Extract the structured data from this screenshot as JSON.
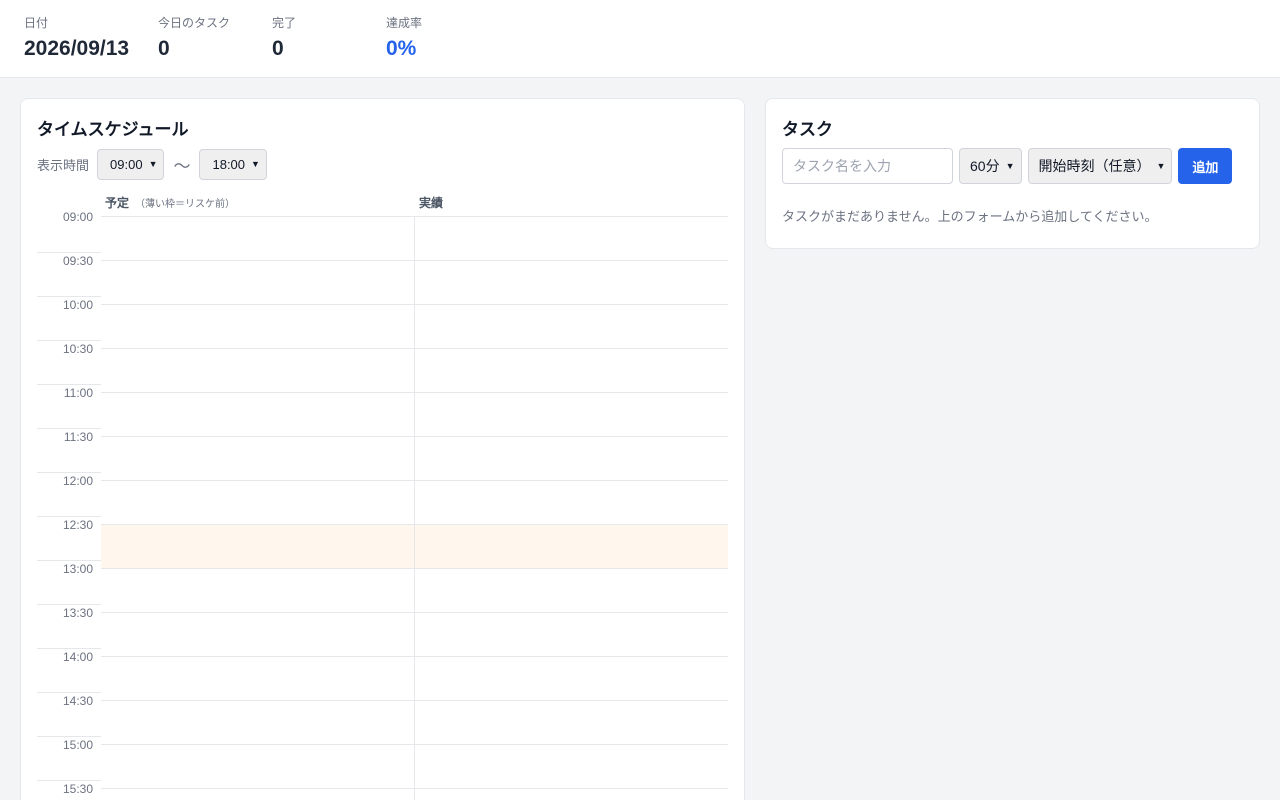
{
  "stats": [
    {
      "label": "日付",
      "value": "2026/09/13",
      "accent": false
    },
    {
      "label": "今日のタスク",
      "value": "0",
      "accent": false
    },
    {
      "label": "完了",
      "value": "0",
      "accent": false
    },
    {
      "label": "達成率",
      "value": "0%",
      "accent": true
    }
  ],
  "schedule": {
    "title": "タイムスケジュール",
    "range_label": "表示時間",
    "start_time": "09:00",
    "range_separator": "〜",
    "end_time": "18:00",
    "plan_header": "予定",
    "plan_note": "（薄い枠＝リスケ前）",
    "actual_header": "実績",
    "times": [
      "09:00",
      "09:30",
      "10:00",
      "10:30",
      "11:00",
      "11:30",
      "12:00",
      "12:30",
      "13:00",
      "13:30",
      "14:00",
      "14:30",
      "15:00",
      "15:30"
    ],
    "break_slot": "12:30"
  },
  "tasks": {
    "title": "タスク",
    "name_placeholder": "タスク名を入力",
    "duration": "60分",
    "start_select": "開始時刻（任意）",
    "add_label": "追加",
    "empty_message": "タスクがまだありません。上のフォームから追加してください。"
  },
  "colors": {
    "accent": "#2563eb",
    "break_fill": "#fff7ed"
  }
}
